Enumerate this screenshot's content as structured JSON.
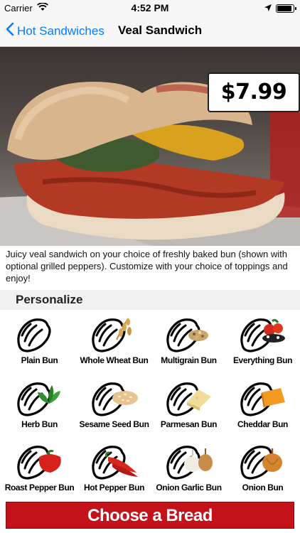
{
  "status_bar": {
    "carrier": "Carrier",
    "time": "4:52 PM"
  },
  "nav": {
    "back_label": "Hot Sandwiches",
    "title": "Veal Sandwich"
  },
  "item": {
    "price": "$7.99",
    "description": "Juicy veal sandwich on your choice of freshly baked bun (shown with optional grilled peppers).  Customize with your choice of toppings and enjoy!"
  },
  "personalize": {
    "title": "Personalize",
    "options": [
      {
        "label": "Plain Bun",
        "topping": "none"
      },
      {
        "label": "Whole Wheat Bun",
        "topping": "wheat"
      },
      {
        "label": "Multigrain Bun",
        "topping": "grain"
      },
      {
        "label": "Everything Bun",
        "topping": "everything"
      },
      {
        "label": "Herb Bun",
        "topping": "herb"
      },
      {
        "label": "Sesame Seed Bun",
        "topping": "sesame"
      },
      {
        "label": "Parmesan Bun",
        "topping": "parmesan"
      },
      {
        "label": "Cheddar Bun",
        "topping": "cheddar"
      },
      {
        "label": "Roast Pepper Bun",
        "topping": "roast-pepper"
      },
      {
        "label": "Hot Pepper Bun",
        "topping": "hot-pepper"
      },
      {
        "label": "Onion Garlic Bun",
        "topping": "onion-garlic"
      },
      {
        "label": "Onion Bun",
        "topping": "onion"
      }
    ]
  },
  "cta": {
    "label": "Choose a Bread"
  },
  "colors": {
    "accent": "#0a7aff",
    "cta": "#c4121a"
  }
}
